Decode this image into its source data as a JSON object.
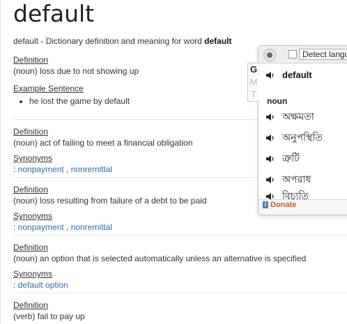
{
  "title": "default",
  "subtitle": {
    "prefix": "default - Dictionary definition and meaning for word ",
    "word": "default"
  },
  "entries": [
    {
      "definition_label": "Definition",
      "definition": "(noun) loss due to not showing up",
      "example_label": "Example Sentence",
      "examples": [
        "he lost the game by default"
      ]
    },
    {
      "definition_label": "Definition",
      "definition": "(noun) act of failing to meet a financial obligation",
      "synonyms_label": "Synonyms",
      "synonyms": [
        "nonpayment",
        "nonremittal"
      ]
    },
    {
      "definition_label": "Definition",
      "definition": "(noun) loss resulting from failure of a debt to be paid",
      "synonyms_label": "Synonyms",
      "synonyms": [
        "nonpayment",
        "nonremittal"
      ]
    },
    {
      "definition_label": "Definition",
      "definition": "(noun) an option that is selected automatically unless an alternative is specified",
      "synonyms_label": "Synonyms",
      "synonyms": [
        "default option"
      ]
    },
    {
      "definition_label": "Definition",
      "definition": "(verb) fail to pay up"
    }
  ],
  "popup": {
    "detect_label": "Detect langu",
    "tabs": [
      "G",
      "M",
      "T"
    ],
    "word": "default",
    "pos": "noun",
    "translations": [
      "অক্ষমতা",
      "অনুপস্থিতি",
      "ত্রুটি",
      "অপরাধ",
      "বিচ্যুতি"
    ],
    "donate": "Donate"
  },
  "colors": {
    "link": "#2a6fb0",
    "donate": "#c25a2a"
  }
}
